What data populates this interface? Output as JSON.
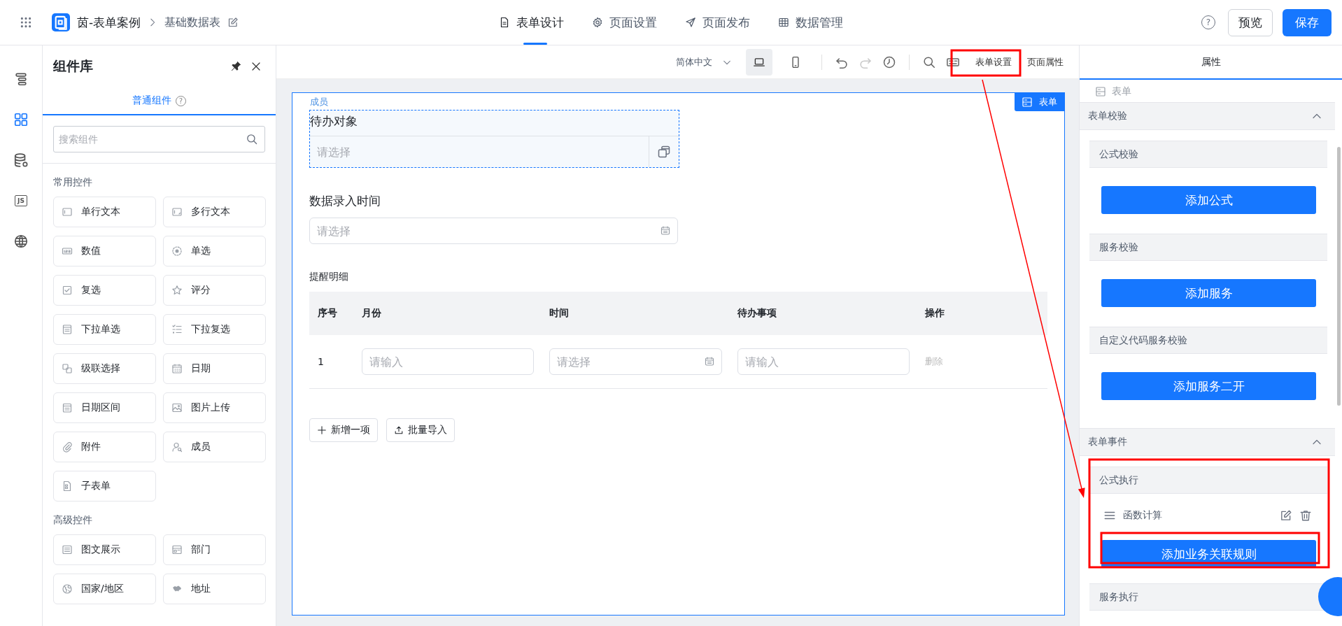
{
  "topbar": {
    "app_name": "茵-表单案例",
    "page_name": "基础数据表",
    "nav": [
      {
        "label": "表单设计",
        "kind": "document",
        "selected": true
      },
      {
        "label": "页面设置",
        "kind": "gear",
        "selected": false
      },
      {
        "label": "页面发布",
        "kind": "send",
        "selected": false
      },
      {
        "label": "数据管理",
        "kind": "table",
        "selected": false
      }
    ],
    "help": "?",
    "preview": "预览",
    "save": "保存"
  },
  "rail": [
    {
      "kind": "outline",
      "selected": false
    },
    {
      "kind": "components",
      "selected": true
    },
    {
      "kind": "database",
      "selected": false
    },
    {
      "kind": "js",
      "label": "JS",
      "selected": false
    },
    {
      "kind": "globe",
      "selected": false
    }
  ],
  "library": {
    "title": "组件库",
    "tabs": [
      {
        "label": "普通组件",
        "help": "?",
        "selected": true
      }
    ],
    "search_placeholder": "搜索组件",
    "groups": [
      {
        "title": "常用控件",
        "items": [
          {
            "label": "单行文本",
            "kind": "text"
          },
          {
            "label": "多行文本",
            "kind": "textarea"
          },
          {
            "label": "数值",
            "kind": "number"
          },
          {
            "label": "单选",
            "kind": "radio"
          },
          {
            "label": "复选",
            "kind": "checkbox"
          },
          {
            "label": "评分",
            "kind": "star"
          },
          {
            "label": "下拉单选",
            "kind": "dropdown"
          },
          {
            "label": "下拉复选",
            "kind": "checklist"
          },
          {
            "label": "级联选择",
            "kind": "cascade"
          },
          {
            "label": "日期",
            "kind": "calendar"
          },
          {
            "label": "日期区间",
            "kind": "daterange"
          },
          {
            "label": "图片上传",
            "kind": "image"
          },
          {
            "label": "附件",
            "kind": "attachment"
          },
          {
            "label": "成员",
            "kind": "member"
          },
          {
            "label": "子表单",
            "kind": "subform"
          }
        ]
      },
      {
        "title": "高级控件",
        "items": [
          {
            "label": "图文展示",
            "kind": "richtext"
          },
          {
            "label": "部门",
            "kind": "department"
          },
          {
            "label": "国家/地区",
            "kind": "region"
          },
          {
            "label": "地址",
            "kind": "address"
          }
        ]
      }
    ]
  },
  "toolbar": {
    "language": "简体中文",
    "devices": [
      {
        "kind": "desktop",
        "selected": true
      },
      {
        "kind": "mobile",
        "selected": false
      }
    ],
    "tools": [
      {
        "kind": "undo",
        "disabled": false
      },
      {
        "kind": "redo",
        "disabled": true
      },
      {
        "kind": "history",
        "disabled": false
      },
      {
        "kind": "search",
        "disabled": false
      },
      {
        "kind": "keyboard",
        "disabled": false
      }
    ],
    "links": [
      "表单设置",
      "页面属性"
    ]
  },
  "form": {
    "badge": "表单",
    "member_field": {
      "tag": "成员",
      "label": "待办对象",
      "placeholder": "请选择",
      "selected": true
    },
    "date_field": {
      "label": "数据录入时间",
      "placeholder": "请选择"
    },
    "subform": {
      "title": "提醒明细",
      "columns": [
        "序号",
        "月份",
        "时间",
        "待办事项",
        "操作"
      ],
      "rows": [
        {
          "cells": [
            {
              "kind": "index",
              "text": "1"
            },
            {
              "kind": "text",
              "placeholder": "请输入"
            },
            {
              "kind": "date",
              "placeholder": "请选择"
            },
            {
              "kind": "text",
              "placeholder": "请输入"
            },
            {
              "kind": "action",
              "text": "删除",
              "disabled": true
            }
          ]
        }
      ],
      "buttons": [
        {
          "kind": "add",
          "label": "新增一项"
        },
        {
          "kind": "import",
          "label": "批量导入"
        }
      ]
    }
  },
  "properties": {
    "tabs": [
      {
        "label": "属性",
        "selected": true
      }
    ],
    "crumb": "表单",
    "sections": [
      {
        "title": "表单校验",
        "expanded": true,
        "groups": [
          {
            "title": "公式校验",
            "button": "添加公式"
          },
          {
            "title": "服务校验",
            "button": "添加服务"
          },
          {
            "title": "自定义代码服务校验",
            "button": "添加服务二开"
          }
        ]
      },
      {
        "title": "表单事件",
        "expanded": true,
        "groups": [
          {
            "title": "公式执行",
            "rules": [
              {
                "label": "函数计算"
              }
            ],
            "button": "添加业务关联规则"
          },
          {
            "title": "服务执行"
          }
        ]
      }
    ]
  }
}
